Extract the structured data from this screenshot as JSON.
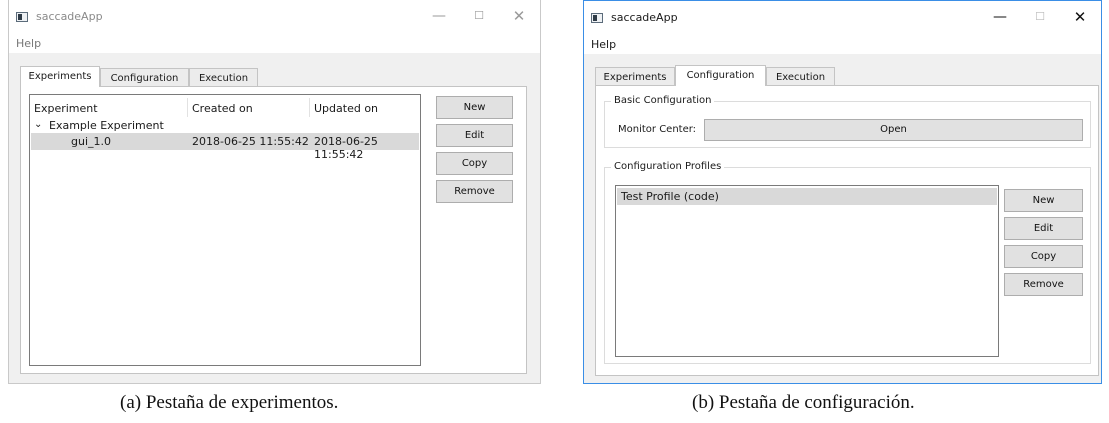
{
  "window_a": {
    "title": "saccadeApp",
    "controls": {
      "minimize": "—",
      "maximize": "☐",
      "close": "✕"
    },
    "menu": {
      "help": "Help"
    },
    "tabs": [
      "Experiments",
      "Configuration",
      "Execution"
    ],
    "active_tab": "Experiments",
    "experiments_table": {
      "columns": [
        "Experiment",
        "Created on",
        "Updated on"
      ],
      "group": {
        "name": "Example Experiment",
        "expanded": true
      },
      "rows": [
        {
          "experiment": "gui_1.0",
          "created": "2018-06-25 11:55:42",
          "updated": "2018-06-25 11:55:42",
          "selected": true
        }
      ]
    },
    "buttons": {
      "new": "New",
      "edit": "Edit",
      "copy": "Copy",
      "remove": "Remove"
    }
  },
  "window_b": {
    "title": "saccadeApp",
    "controls": {
      "minimize": "—",
      "maximize": "☐",
      "close": "✕"
    },
    "menu": {
      "help": "Help"
    },
    "tabs": [
      "Experiments",
      "Configuration",
      "Execution"
    ],
    "active_tab": "Configuration",
    "basic_configuration": {
      "title": "Basic Configuration",
      "monitor_center_label": "Monitor Center:",
      "open_button": "Open"
    },
    "configuration_profiles": {
      "title": "Configuration Profiles",
      "items": [
        {
          "label": "Test Profile (code)",
          "selected": true
        }
      ],
      "buttons": {
        "new": "New",
        "edit": "Edit",
        "copy": "Copy",
        "remove": "Remove"
      }
    }
  },
  "captions": {
    "a": "(a) Pestaña de experimentos.",
    "b": "(b) Pestaña de configuración."
  },
  "colors": {
    "selection": "#d9d9d9",
    "active_window_border": "#3a8ee6",
    "button_face": "#e1e1e1"
  }
}
